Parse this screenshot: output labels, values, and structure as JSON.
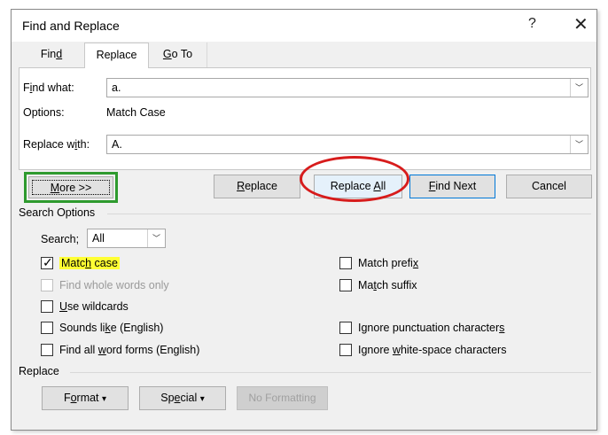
{
  "window": {
    "title": "Find and Replace",
    "help_label": "?",
    "close_label": "✕"
  },
  "tabs": [
    {
      "pre": "Fin",
      "ul": "d",
      "post": ""
    },
    {
      "pre": "Replace",
      "ul": "",
      "post": ""
    },
    {
      "pre": "",
      "ul": "G",
      "post": "o To"
    }
  ],
  "find": {
    "label_pre": "F",
    "label_ul": "i",
    "label_post": "nd what:",
    "value": "a."
  },
  "options": {
    "label": "Options:",
    "value": "Match Case"
  },
  "replace": {
    "label_pre": "Replace w",
    "label_ul": "i",
    "label_post": "th:",
    "value": "A."
  },
  "buttons": {
    "more_ul": "M",
    "more_post": "ore >>",
    "replace_ul": "R",
    "replace_post": "eplace",
    "replace_all_pre": "Replace ",
    "replace_all_ul": "A",
    "replace_all_post": "ll",
    "find_next_ul": "F",
    "find_next_post": "ind Next",
    "cancel": "Cancel"
  },
  "search_options": {
    "title": "Search Options",
    "search_label": "Search;",
    "search_value": "All"
  },
  "checkboxes_left": [
    {
      "pre": "Matc",
      "ul": "h",
      "post": " case",
      "checked": true,
      "disabled": false,
      "highlight": true
    },
    {
      "pre": "Find whole words only",
      "ul": "",
      "post": "",
      "checked": false,
      "disabled": true,
      "highlight": false
    },
    {
      "pre": "",
      "ul": "U",
      "post": "se wildcards",
      "checked": false,
      "disabled": false,
      "highlight": false
    },
    {
      "pre": "Sounds li",
      "ul": "k",
      "post": "e (English)",
      "checked": false,
      "disabled": false,
      "highlight": false
    },
    {
      "pre": "Find all ",
      "ul": "w",
      "post": "ord forms (English)",
      "checked": false,
      "disabled": false,
      "highlight": false
    }
  ],
  "checkboxes_right": [
    {
      "pre": "Match prefi",
      "ul": "x",
      "post": "",
      "checked": false
    },
    {
      "pre": "Ma",
      "ul": "t",
      "post": "ch suffix",
      "checked": false
    },
    {
      "pre": "Ignore punctuation character",
      "ul": "s",
      "post": "",
      "checked": false
    },
    {
      "pre": "Ignore ",
      "ul": "w",
      "post": "hite-space characters",
      "checked": false
    }
  ],
  "replace_section": {
    "title": "Replace",
    "format_pre": "F",
    "format_ul": "o",
    "format_post": "rmat",
    "special_pre": "Sp",
    "special_ul": "e",
    "special_post": "cial",
    "dropdown_glyph": "▾",
    "no_formatting": "No Formatting"
  },
  "colors": {
    "highlight": "#ffff33",
    "annotation_oval": "#d71c1c",
    "annotation_box": "#2e9a2e",
    "focus": "#0078d7"
  },
  "icons": {
    "checkmark": "✓",
    "combo_arrow": "﹀"
  }
}
